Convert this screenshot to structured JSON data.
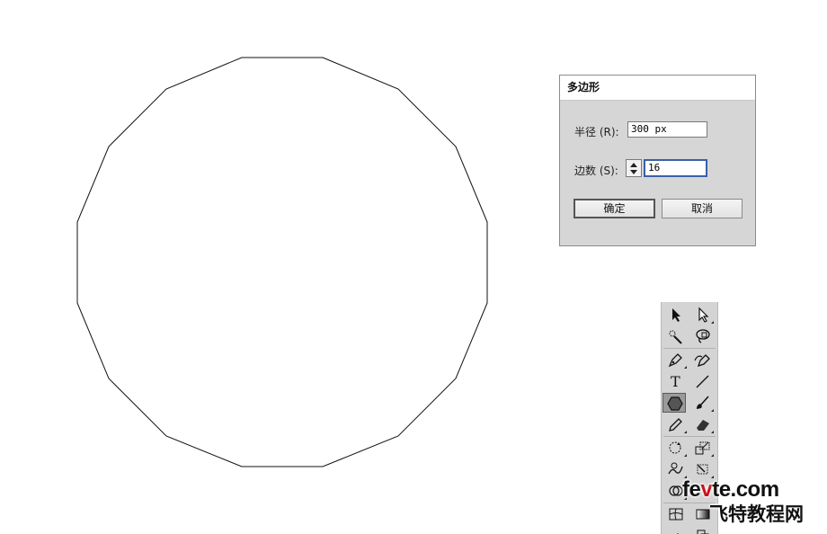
{
  "canvas": {
    "shape": "16-sided polygon",
    "stroke_color": "#111111"
  },
  "dialog": {
    "title": "多边形",
    "radius_label": "半径 (R):",
    "radius_value": "300 px",
    "sides_label": "边数 (S):",
    "sides_value": "16",
    "ok_label": "确定",
    "cancel_label": "取消"
  },
  "toolbox": {
    "tools": [
      "selection-tool-icon",
      "direct-selection-tool-icon",
      "magic-wand-tool-icon",
      "lasso-tool-icon",
      "pen-tool-icon",
      "curvature-tool-icon",
      "type-tool-icon",
      "line-segment-tool-icon",
      "polygon-tool-icon",
      "paintbrush-tool-icon",
      "pencil-tool-icon",
      "eraser-tool-icon",
      "rotate-tool-icon",
      "scale-tool-icon",
      "warp-tool-icon",
      "free-transform-tool-icon",
      "shape-builder-tool-icon",
      "mesh-tool-icon",
      "gradient-tool-icon"
    ],
    "active_tool": "polygon-tool-icon"
  },
  "watermark": {
    "domain_prefix": "fe",
    "domain_v": "v",
    "domain_suffix": "te.com",
    "site_name": "飞特教程网"
  }
}
